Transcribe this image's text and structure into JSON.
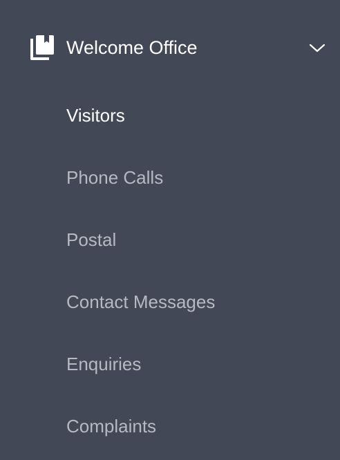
{
  "sidebar": {
    "section": {
      "title": "Welcome Office",
      "icon": "book-icon",
      "expand_icon": "chevron-down-icon",
      "expanded": true
    },
    "items": [
      {
        "label": "Visitors",
        "active": true
      },
      {
        "label": "Phone Calls",
        "active": false
      },
      {
        "label": "Postal",
        "active": false
      },
      {
        "label": "Contact Messages",
        "active": false
      },
      {
        "label": "Enquiries",
        "active": false
      },
      {
        "label": "Complaints",
        "active": false
      }
    ]
  },
  "colors": {
    "background": "#434857",
    "active_text": "#ffffff",
    "inactive_text": "#b6b9c1"
  }
}
